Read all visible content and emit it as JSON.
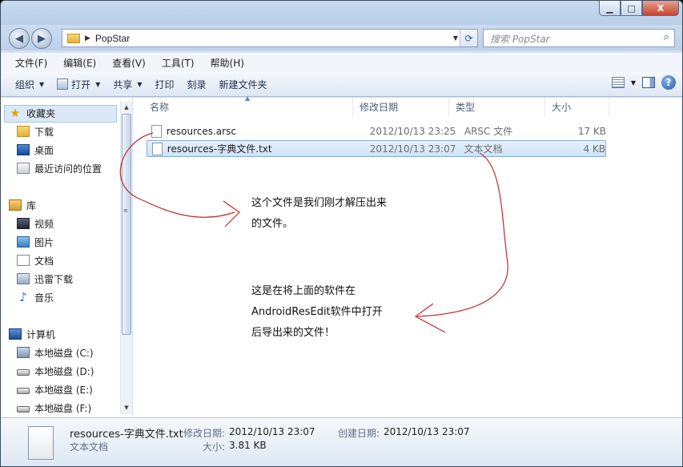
{
  "window": {
    "minimize": "▁",
    "maximize": "□",
    "close": "X"
  },
  "address": {
    "path": "PopStar",
    "search_placeholder": "搜索 PopStar"
  },
  "menu": [
    "文件(F)",
    "编辑(E)",
    "查看(V)",
    "工具(T)",
    "帮助(H)"
  ],
  "toolbar": {
    "organize": "组织",
    "open": "打开",
    "share": "共享",
    "print": "打印",
    "burn": "刻录",
    "new_folder": "新建文件夹"
  },
  "sidebar": {
    "favorites": {
      "title": "收藏夹",
      "items": [
        "下载",
        "桌面",
        "最近访问的位置"
      ]
    },
    "libraries": {
      "title": "库",
      "items": [
        "视频",
        "图片",
        "文档",
        "迅雷下载",
        "音乐"
      ]
    },
    "computer": {
      "title": "计算机",
      "items": [
        "本地磁盘 (C:)",
        "本地磁盘 (D:)",
        "本地磁盘 (E:)",
        "本地磁盘 (F:)"
      ]
    }
  },
  "columns": {
    "name": "名称",
    "date": "修改日期",
    "type": "类型",
    "size": "大小"
  },
  "files": [
    {
      "name": "resources.arsc",
      "date": "2012/10/13 23:25",
      "type": "ARSC 文件",
      "size": "17 KB"
    },
    {
      "name": "resources-字典文件.txt",
      "date": "2012/10/13 23:07",
      "type": "文本文档",
      "size": "4 KB"
    }
  ],
  "annotations": {
    "note1": [
      "这个文件是我们刚才解压出来",
      "的文件。"
    ],
    "note2": [
      "这是在将上面的软件在",
      "AndroidResEdit软件中打开",
      "后导出来的文件！"
    ]
  },
  "details": {
    "filename": "resources-字典文件.txt",
    "filetype": "文本文档",
    "modified_label": "修改日期:",
    "modified_value": "2012/10/13 23:07",
    "created_label": "创建日期:",
    "created_value": "2012/10/13 23:07",
    "size_label": "大小:",
    "size_value": "3.81 KB"
  },
  "colors": {
    "annotation_line": "#c62828",
    "selection": "#cfe2f8"
  }
}
